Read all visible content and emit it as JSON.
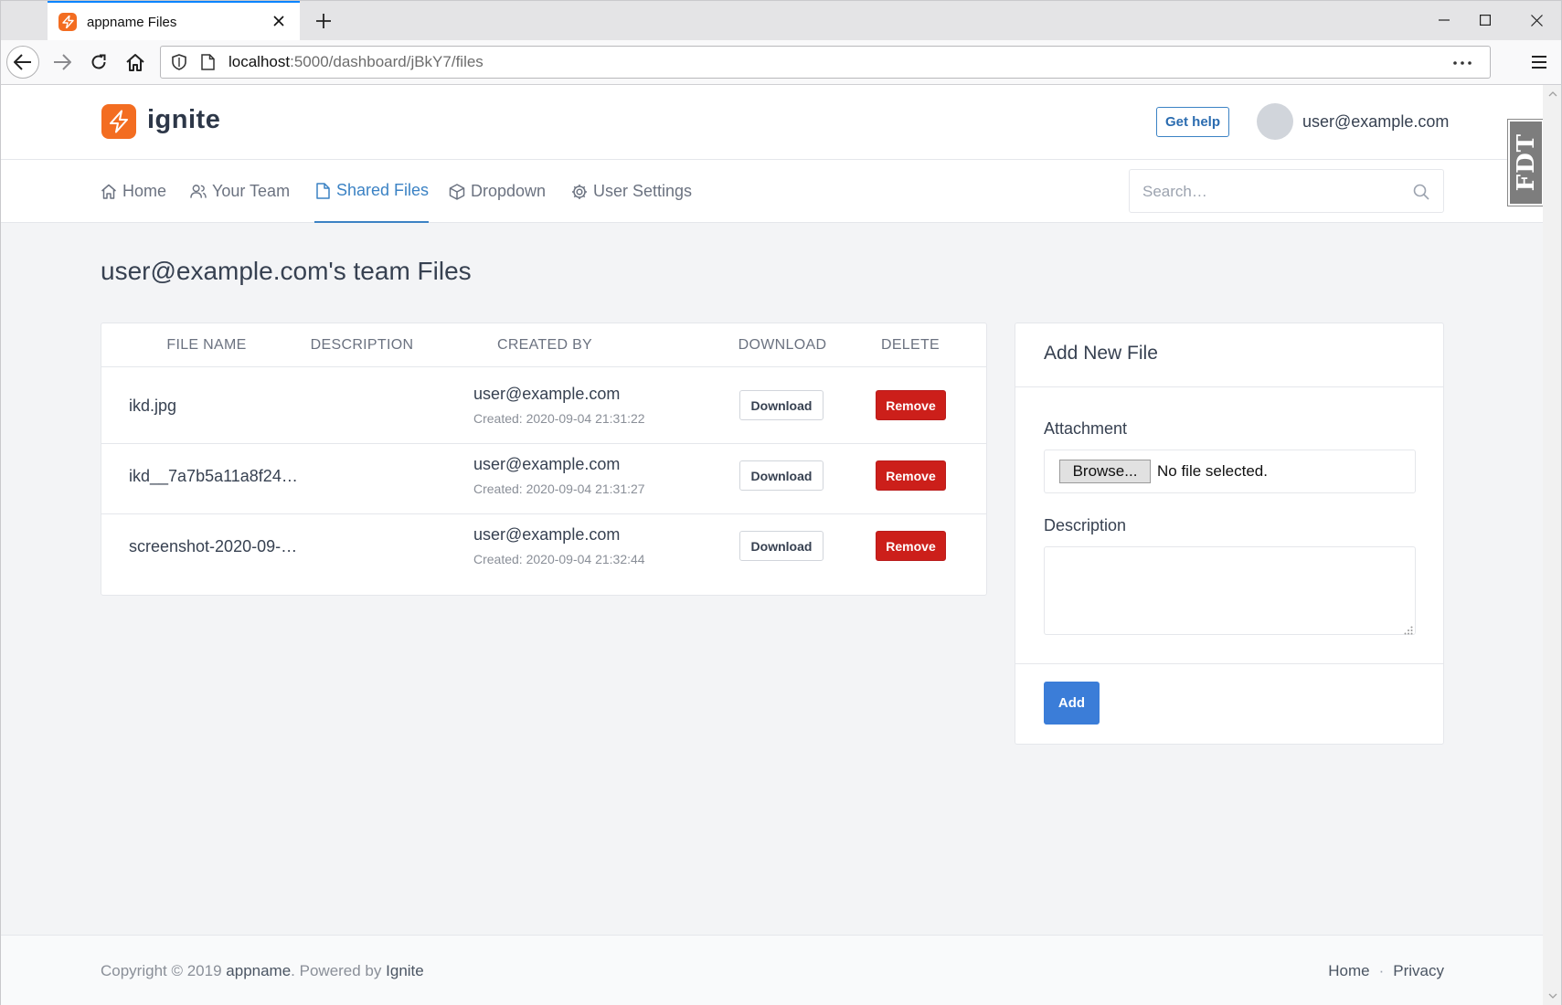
{
  "browser": {
    "tab_title": "appname Files",
    "url_host": "localhost",
    "url_rest": ":5000/dashboard/jBkY7/files"
  },
  "header": {
    "logo_text": "ignite",
    "help_label": "Get help",
    "user_email": "user@example.com"
  },
  "nav": {
    "items": [
      {
        "label": "Home",
        "icon": "home-icon"
      },
      {
        "label": "Your Team",
        "icon": "users-icon"
      },
      {
        "label": "Shared Files",
        "icon": "file-icon",
        "active": true
      },
      {
        "label": "Dropdown",
        "icon": "cube-icon"
      },
      {
        "label": "User Settings",
        "icon": "gear-icon"
      }
    ],
    "search_placeholder": "Search…"
  },
  "badge": {
    "text": "FDT"
  },
  "page": {
    "title": "user@example.com's team Files"
  },
  "files_table": {
    "columns": [
      "FILE NAME",
      "DESCRIPTION",
      "CREATED BY",
      "DOWNLOAD",
      "DELETE"
    ],
    "rows": [
      {
        "name": "ikd.jpg",
        "description": "",
        "created_by": "user@example.com",
        "created": "Created: 2020-09-04 21:31:22",
        "download_label": "Download",
        "remove_label": "Remove"
      },
      {
        "name": "ikd__7a7b5a11a8f24…",
        "description": "",
        "created_by": "user@example.com",
        "created": "Created: 2020-09-04 21:31:27",
        "download_label": "Download",
        "remove_label": "Remove"
      },
      {
        "name": "screenshot-2020-09-…",
        "description": "",
        "created_by": "user@example.com",
        "created": "Created: 2020-09-04 21:32:44",
        "download_label": "Download",
        "remove_label": "Remove"
      }
    ]
  },
  "add_file": {
    "title": "Add New File",
    "attachment_label": "Attachment",
    "browse_label": "Browse...",
    "file_status": "No file selected.",
    "description_label": "Description",
    "description_value": "",
    "submit_label": "Add"
  },
  "footer": {
    "copyright_prefix": "Copyright © 2019",
    "app_name": "appname",
    "powered_by": ". Powered by",
    "powered_name": "Ignite",
    "links": [
      "Home",
      "Privacy"
    ],
    "separator": "·"
  },
  "colors": {
    "brand_orange": "#f36d21",
    "link_blue": "#3b82c4",
    "remove_red": "#cc1f1a",
    "add_blue": "#3b7dd8"
  }
}
